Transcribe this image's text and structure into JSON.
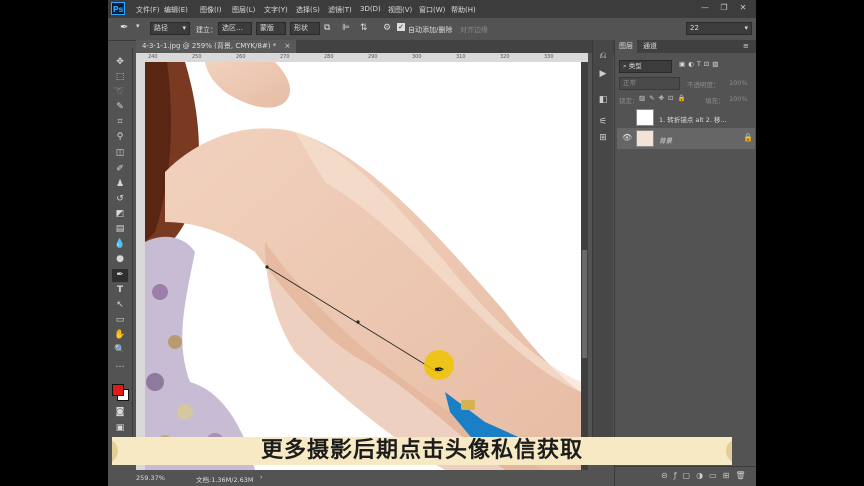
{
  "app": {
    "logo": "Ps"
  },
  "menu": [
    "文件(F)",
    "编辑(E)",
    "图像(I)",
    "图层(L)",
    "文字(Y)",
    "选择(S)",
    "滤镜(T)",
    "3D(D)",
    "视图(V)",
    "窗口(W)",
    "帮助(H)"
  ],
  "options": {
    "mode_value": "路径",
    "build_label": "建立：",
    "selection_btn": "选区…",
    "mask_btn": "蒙版",
    "shape_btn": "形状",
    "auto_add_label": "自动添加/删除",
    "align_edges_label": "对齐边缘",
    "workspace_value": "22"
  },
  "document": {
    "tab_title": "4-3-1-1.jpg @ 259% (背景, CMYK/8#) *",
    "tab_close": "×"
  },
  "ruler": {
    "ticks": [
      "240",
      "250",
      "260",
      "270",
      "280",
      "290",
      "300",
      "310",
      "320",
      "330"
    ]
  },
  "status": {
    "zoom": "259.37%",
    "doc_info": "文档:1.36M/2.63M"
  },
  "panel": {
    "tab_layers": "图层",
    "tab_channels": "通道",
    "filter_kind": "类型",
    "blend_mode": "正常",
    "opacity_label": "不透明度：",
    "opacity_value": "100%",
    "lock_label": "锁定：",
    "fill_label": "填充：",
    "fill_value": "100%",
    "layers": [
      {
        "name": "1. 转折锚点    alt  2. 移..."
      },
      {
        "name": "背景"
      }
    ]
  },
  "banner": {
    "text": "更多摄影后期点击头像私信获取",
    "color": "#f6e9c4"
  },
  "colors": {
    "foreground": "#e21a1a",
    "background": "#ffffff"
  },
  "icons": {
    "pen": "pen-icon",
    "move": "move-icon",
    "lasso": "lasso-icon",
    "crop": "crop-icon",
    "brush": "brush-icon",
    "eraser": "eraser-icon",
    "type": "type-icon",
    "hand": "hand-icon",
    "zoom": "zoom-icon"
  }
}
